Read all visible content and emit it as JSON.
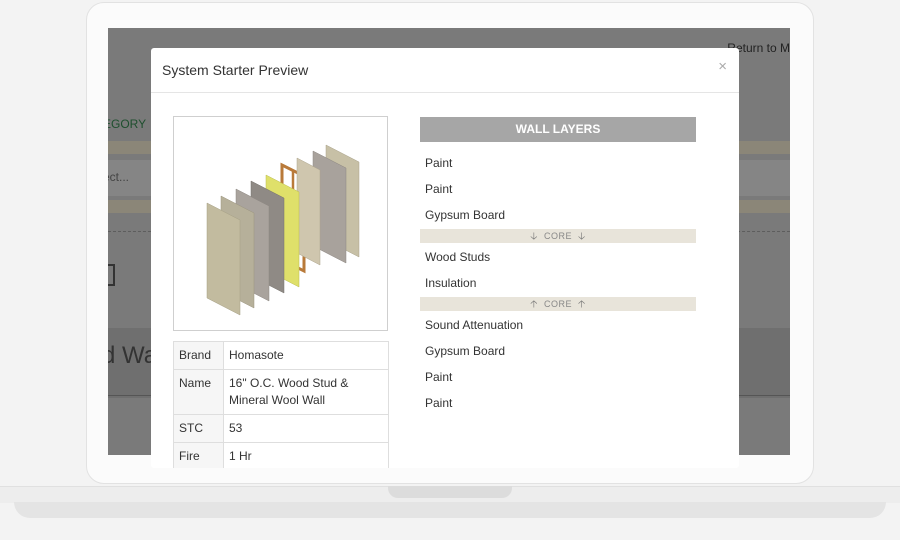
{
  "background_page": {
    "return_link": "Return to M",
    "category_tab": "EGORY",
    "select_placeholder": "ect...",
    "heading": "d Wa"
  },
  "modal": {
    "title": "System Starter Preview",
    "close_icon": "×"
  },
  "product_table": [
    {
      "key": "Brand",
      "value": "Homasote"
    },
    {
      "key": "Name",
      "value": "16\" O.C. Wood Stud & Mineral Wool Wall"
    },
    {
      "key": "STC",
      "value": "53"
    },
    {
      "key": "Fire",
      "value": "1 Hr"
    }
  ],
  "wall_layers": {
    "header": "WALL LAYERS",
    "exterior": [
      "Paint",
      "Paint",
      "Gypsum Board"
    ],
    "core_label": "CORE",
    "core": [
      "Wood Studs",
      "Insulation"
    ],
    "interior": [
      "Sound Attenuation",
      "Gypsum Board",
      "Paint",
      "Paint"
    ]
  },
  "colors": {
    "layer_header_bg": "#a6a6a6",
    "core_bar_bg": "#e8e4da",
    "overlay": "#7a7a7a"
  }
}
